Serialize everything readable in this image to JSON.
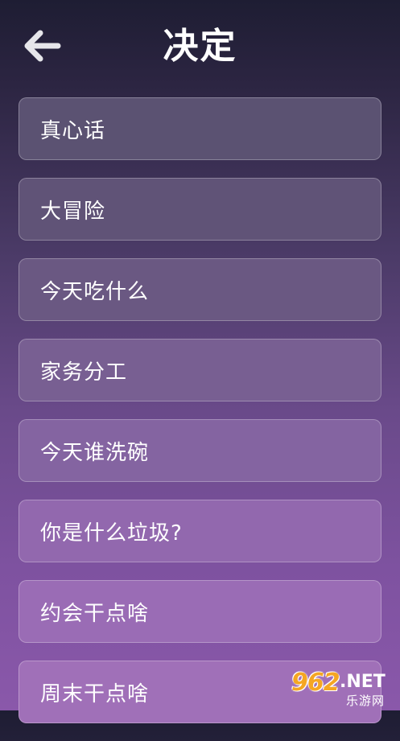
{
  "header": {
    "title": "决定",
    "back_icon": "arrow-left-icon"
  },
  "items": [
    {
      "label": "真心话",
      "bg": "#5b5272"
    },
    {
      "label": "大冒险",
      "bg": "#605377"
    },
    {
      "label": "今天吃什么",
      "bg": "#6a5882"
    },
    {
      "label": "家务分工",
      "bg": "#785f92"
    },
    {
      "label": "今天谁洗碗",
      "bg": "#8464a1"
    },
    {
      "label": "你是什么垃圾?",
      "bg": "#9268ae"
    },
    {
      "label": "约会干点啥",
      "bg": "#9a6cb5"
    },
    {
      "label": "周末干点啥",
      "bg": "#a070b8"
    }
  ],
  "watermark": {
    "number": "962",
    "domain": ".NET",
    "site": "乐游网"
  }
}
